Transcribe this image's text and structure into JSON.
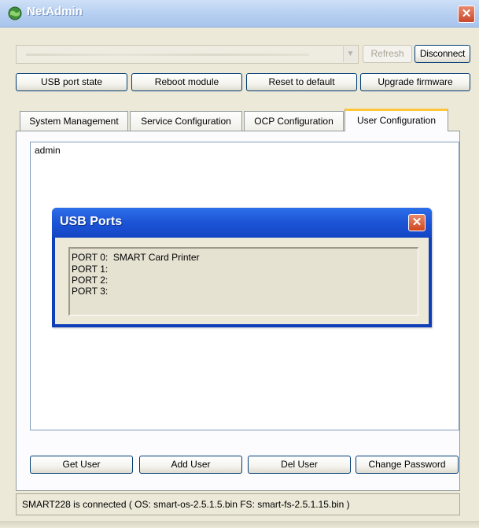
{
  "window": {
    "title": "NetAdmin",
    "icon": "globe-app-icon"
  },
  "connection": {
    "refresh_label": "Refresh",
    "disconnect_label": "Disconnect"
  },
  "actions": {
    "usb_port_state": "USB port state",
    "reboot_module": "Reboot module",
    "reset_to_default": "Reset to default",
    "upgrade_firmware": "Upgrade firmware"
  },
  "tabs": [
    {
      "label": "System Management"
    },
    {
      "label": "Service Configuration"
    },
    {
      "label": "OCP Configuration"
    },
    {
      "label": "User Configuration",
      "active": true
    }
  ],
  "users": [
    "admin"
  ],
  "user_buttons": {
    "get_user": "Get User",
    "add_user": "Add User",
    "del_user": "Del User",
    "change_password": "Change Password"
  },
  "status": "SMART228 is connected ( OS: smart-os-2.5.1.5.bin  FS: smart-fs-2.5.1.15.bin )",
  "usb_dialog": {
    "title": "USB Ports",
    "ports": [
      "PORT 0:  SMART Card Printer",
      "PORT 1:",
      "PORT 2:",
      "PORT 3:"
    ]
  },
  "colors": {
    "window_bg": "#ece9d8",
    "dialog_title": "#1c54d6",
    "active_tab_accent": "#ffc83c",
    "close_button": "#cf4620"
  }
}
